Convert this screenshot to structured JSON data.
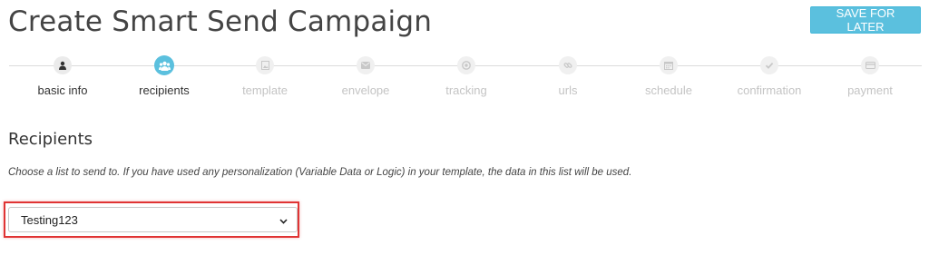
{
  "page_title": "Create Smart Send Campaign",
  "save_button_label": "SAVE FOR LATER",
  "colors": {
    "accent": "#5bc0de",
    "highlight": "#e03434",
    "inactive_step": "#c4c4c4"
  },
  "steps": [
    {
      "label": "basic info",
      "icon": "person-icon",
      "state": "done"
    },
    {
      "label": "recipients",
      "icon": "users-icon",
      "state": "active"
    },
    {
      "label": "template",
      "icon": "image-icon",
      "state": "pending"
    },
    {
      "label": "envelope",
      "icon": "envelope-icon",
      "state": "pending"
    },
    {
      "label": "tracking",
      "icon": "target-icon",
      "state": "pending"
    },
    {
      "label": "urls",
      "icon": "link-icon",
      "state": "pending"
    },
    {
      "label": "schedule",
      "icon": "calendar-icon",
      "state": "pending"
    },
    {
      "label": "confirmation",
      "icon": "check-icon",
      "state": "pending"
    },
    {
      "label": "payment",
      "icon": "credit-card-icon",
      "state": "pending"
    }
  ],
  "recipients": {
    "heading": "Recipients",
    "help_text": "Choose a list to send to. If you have used any personalization (Variable Data or Logic) in your template, the data in this list will be used.",
    "selected_list": "Testing123"
  }
}
